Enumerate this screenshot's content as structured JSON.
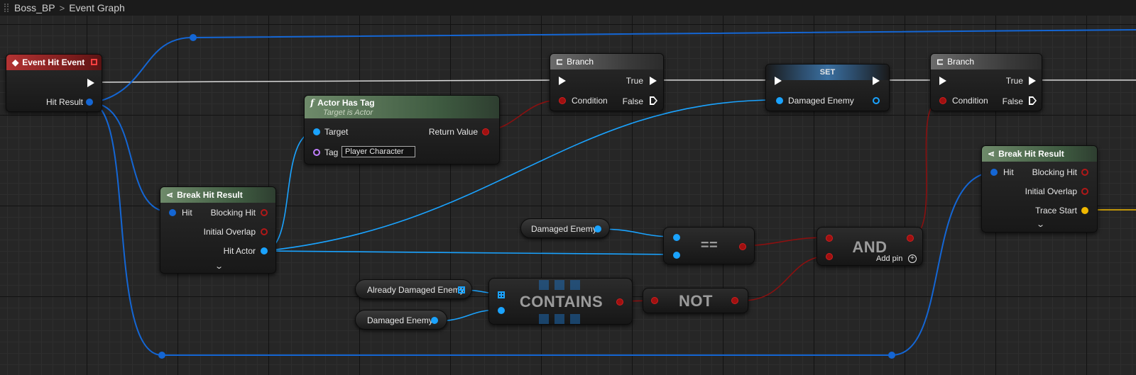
{
  "breadcrumb": {
    "root": "Boss_BP",
    "separator": ">",
    "current": "Event Graph"
  },
  "nodes": {
    "event_hit": {
      "title": "Event Hit Event",
      "pin_hit_result": "Hit Result"
    },
    "branch1": {
      "title": "Branch",
      "pin_condition": "Condition",
      "pin_true": "True",
      "pin_false": "False"
    },
    "actor_has_tag": {
      "title": "Actor Has Tag",
      "subtitle": "Target is Actor",
      "pin_target": "Target",
      "pin_return": "Return Value",
      "pin_tag": "Tag",
      "tag_value": "Player Character"
    },
    "set": {
      "title": "SET",
      "pin_damaged_enemy": "Damaged Enemy"
    },
    "branch2": {
      "title": "Branch",
      "pin_condition": "Condition",
      "pin_true": "True",
      "pin_false": "False"
    },
    "break_hit_1": {
      "title": "Break Hit Result",
      "pin_hit": "Hit",
      "pin_blocking_hit": "Blocking Hit",
      "pin_initial_overlap": "Initial Overlap",
      "pin_hit_actor": "Hit Actor"
    },
    "break_hit_2": {
      "title": "Break Hit Result",
      "pin_hit": "Hit",
      "pin_blocking_hit": "Blocking Hit",
      "pin_initial_overlap": "Initial Overlap",
      "pin_trace_start": "Trace Start"
    },
    "var_damaged_enemy_1": {
      "label": "Damaged Enemy"
    },
    "equals": {
      "label": "=="
    },
    "and": {
      "label": "AND",
      "add_pin": "Add pin"
    },
    "var_already_damaged": {
      "label": "Already Damaged Enemy"
    },
    "var_damaged_enemy_2": {
      "label": "Damaged Enemy"
    },
    "contains": {
      "label": "CONTAINS"
    },
    "not": {
      "label": "NOT"
    }
  },
  "icons": {
    "event": "event-diamond-icon",
    "branch": "branch-icon",
    "function": "function-f-icon",
    "break": "break-struct-icon",
    "array": "array-grid-icon",
    "add": "add-circle-icon",
    "expand": "chevron-down-icon"
  },
  "colors": {
    "exec_wire": "#d8d8d8",
    "object_wire": "#1466d4",
    "actor_wire": "#1aa3ff",
    "bool_wire": "#8a1010",
    "vector_wire": "#f0b800",
    "event_header": "#b33333",
    "function_header": "#3e5a40"
  }
}
